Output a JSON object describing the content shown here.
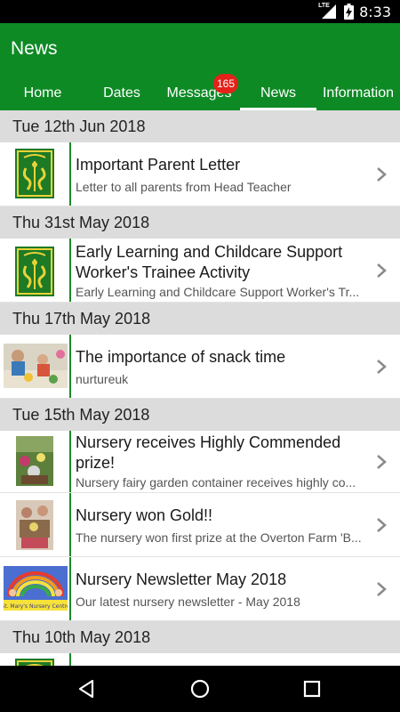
{
  "status_bar": {
    "network": "LTE",
    "time": "8:33"
  },
  "app_bar": {
    "title": "News"
  },
  "tabs": [
    {
      "label": "Home"
    },
    {
      "label": "Dates"
    },
    {
      "label": "Messages",
      "badge": "165"
    },
    {
      "label": "News",
      "selected": true
    },
    {
      "label": "Information"
    }
  ],
  "feed": [
    {
      "date": "Tue 12th Jun 2018",
      "items": [
        {
          "title": "Important Parent Letter",
          "subtitle": "Letter to all parents from Head Teacher",
          "thumb": "school-crest"
        }
      ]
    },
    {
      "date": "Thu 31st May 2018",
      "items": [
        {
          "title": "Early Learning and Childcare Support Worker's Trainee Activity",
          "subtitle": "Early Learning and Childcare Support Worker's Tr...",
          "thumb": "school-crest"
        }
      ]
    },
    {
      "date": "Thu 17th May 2018",
      "items": [
        {
          "title": "The importance of snack time",
          "subtitle": "nurtureuk",
          "thumb": "photo-children-snack"
        }
      ]
    },
    {
      "date": "Tue 15th May 2018",
      "items": [
        {
          "title": "Nursery receives Highly Commended prize!",
          "subtitle": "Nursery fairy garden container receives highly co...",
          "thumb": "photo-garden"
        },
        {
          "title": "Nursery won Gold!!",
          "subtitle": "The nursery won first prize at the Overton Farm 'B...",
          "thumb": "photo-group"
        },
        {
          "title": "Nursery Newsletter May 2018",
          "subtitle": "Our latest nursery newsletter - May 2018",
          "thumb": "rainbow-banner",
          "thumb_text": "St. Mary's Nursery Centre"
        }
      ]
    },
    {
      "date": "Thu 10th May 2018",
      "items": [
        {
          "title": "",
          "subtitle": "",
          "thumb": "school-crest"
        }
      ]
    }
  ],
  "colors": {
    "primary": "#0e8a25",
    "badge": "#e2231a",
    "header_bg": "#dcdcdc"
  },
  "nav_bar": [
    "back-icon",
    "home-icon",
    "recents-icon"
  ]
}
